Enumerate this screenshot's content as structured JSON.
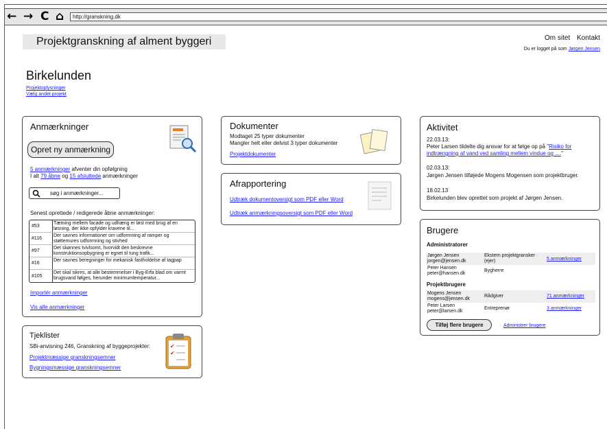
{
  "browser": {
    "url": "http://granskning.dk"
  },
  "header": {
    "site_title": "Projektgranskning af alment byggeri",
    "nav": [
      "Om sitet",
      "Kontakt"
    ],
    "logged_in_prefix": "Du er logget på som ",
    "user_name": "Jørgen Jensen"
  },
  "project": {
    "title": "Birkelunden",
    "links": [
      "Projektoplysninger",
      "Vælg andet projekt"
    ]
  },
  "remarks": {
    "title": "Anmærkninger",
    "create_button": "Opret ny anmærkning",
    "count_link": "5 anmærkninger",
    "count_text": " afventer din opfølgning",
    "total_prefix": "I alt ",
    "open_link": "79 åbne",
    "and_text": " og ",
    "closed_link": "15 afsluttede",
    "total_suffix": " anmærkninger",
    "search_placeholder": "søg i anmærkninger...",
    "recent_label": "Senest oprettede / redigerede åbne anmærkninger:",
    "rows": [
      {
        "id": "#53",
        "text": "Tætning mellem facade og udhæng er løst med brug af en løsning, der ikke opfylder kravene til..."
      },
      {
        "id": "#116",
        "text": "Der savnes informationer om udformning af ramper og støttemures udformning og stivhed"
      },
      {
        "id": "#97",
        "text": "Det skønnes tvivlsomt, hvorvidt den beskrevne konstruktionsopbygning er egnet til tung trafik..."
      },
      {
        "id": "#16",
        "text": "Der savnes beregninger for mekanisk fastholdelse af tagpap"
      },
      {
        "id": "#105",
        "text": "Det skal sikres, at alle bestemmelser i Byg-Erfa blad om varmt brugsvand følges, herunder  minimumtemperatur..."
      }
    ],
    "import_link": "Importér anmærkninger",
    "show_all_link": "Vis alle anmærkninger"
  },
  "checklists": {
    "title": "Tjeklister",
    "subtitle": "SBi-anvisning 246, Granskning af byggeprojekter:",
    "links": [
      "Projektmæssige granskningsemner",
      "Bygningsmæssige granskningsemner"
    ]
  },
  "documents": {
    "title": "Dokumenter",
    "line1": "Modtaget 25 typer dokumenter",
    "line2": "Mangler helt eller delvist 3 typer dokumenter",
    "link": "Projektdokumenter"
  },
  "reporting": {
    "title": "Afrapportering",
    "links": [
      "Udtræk dokumentoversigt som PDF eller Word",
      "Udtræk anmærkningsoversigt som PDF eller Word"
    ]
  },
  "activity": {
    "title": "Aktivitet",
    "items": [
      {
        "date": "22.03.13:",
        "text": "Peter Larsen tildelte dig ansvar for at følge op på \"",
        "link": "Risiko for indtrængning af vand ved samling mellem vindue og ....",
        "suffix": "\""
      },
      {
        "date": "02.03.13:",
        "text": "Jørgen Jensen tilføjede Mogens Mogensen som projektbruger."
      },
      {
        "date": "18.02.13",
        "text": "Birkelunden blev oprettet som projekt af Jørgen Jensen."
      }
    ]
  },
  "users": {
    "title": "Brugere",
    "admins_label": "Administratorer",
    "admins": [
      {
        "name": "Jørgen Jensen",
        "email": "jorgen@jensen.dk",
        "role": "Ekstern projektgransker (ejer)",
        "link": "5 anmærkninger"
      },
      {
        "name": "Peter Hansen",
        "email": "peter@hansen.dk",
        "role": "Bygherre",
        "link": ""
      }
    ],
    "project_users_label": "Projektbrugere",
    "project_users": [
      {
        "name": "Mogens Jensen",
        "email": "mogens@jensen.dk",
        "role": "Rådgiver",
        "link": "71 anmærkninger"
      },
      {
        "name": "Peter Larsen",
        "email": "peter@larsen.dk",
        "role": "Entreprenør",
        "link": "3 anmærkninger"
      }
    ],
    "add_button": "Tilføj flere brugere",
    "manage_link": "Administrer brugere"
  }
}
